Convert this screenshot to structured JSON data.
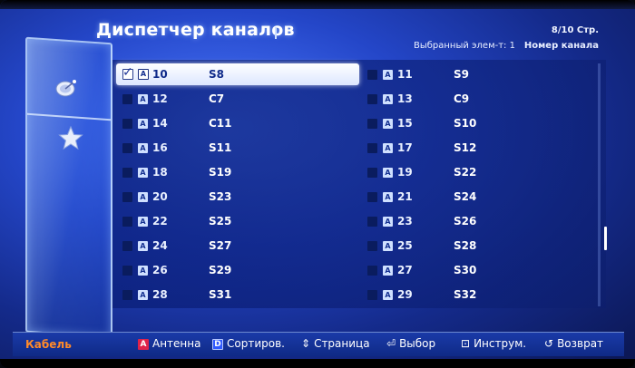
{
  "header": {
    "title": "Диспетчер каналов",
    "page": "8/10 Стр.",
    "selected": "Выбранный элем-т: 1",
    "sort": "Номер канала"
  },
  "icons": {
    "side_top": "satellite-icon",
    "side_bottom": "star-icon",
    "type_badge": "A"
  },
  "channels": [
    [
      {
        "num": "10",
        "name": "S8",
        "checked": true,
        "selected": true
      },
      {
        "num": "11",
        "name": "S9"
      }
    ],
    [
      {
        "num": "12",
        "name": "C7"
      },
      {
        "num": "13",
        "name": "C9"
      }
    ],
    [
      {
        "num": "14",
        "name": "C11"
      },
      {
        "num": "15",
        "name": "S10"
      }
    ],
    [
      {
        "num": "16",
        "name": "S11"
      },
      {
        "num": "17",
        "name": "S12"
      }
    ],
    [
      {
        "num": "18",
        "name": "S19"
      },
      {
        "num": "19",
        "name": "S22"
      }
    ],
    [
      {
        "num": "20",
        "name": "S23"
      },
      {
        "num": "21",
        "name": "S24"
      }
    ],
    [
      {
        "num": "22",
        "name": "S25"
      },
      {
        "num": "23",
        "name": "S26"
      }
    ],
    [
      {
        "num": "24",
        "name": "S27"
      },
      {
        "num": "25",
        "name": "S28"
      }
    ],
    [
      {
        "num": "26",
        "name": "S29"
      },
      {
        "num": "27",
        "name": "S30"
      }
    ],
    [
      {
        "num": "28",
        "name": "S31"
      },
      {
        "num": "29",
        "name": "S32"
      }
    ]
  ],
  "footer": {
    "source": "Кабель",
    "antenna": "Антенна",
    "antenna_key": "A",
    "sort": "Сортиров.",
    "sort_key": "D",
    "page": "Страница",
    "select": "Выбор",
    "tools": "Инструм.",
    "back": "Возврат"
  },
  "colors": {
    "accent_orange": "#ff8a2a",
    "key_red": "#e0224a",
    "key_blue": "#2f59ff",
    "selection": "#ffffff"
  }
}
